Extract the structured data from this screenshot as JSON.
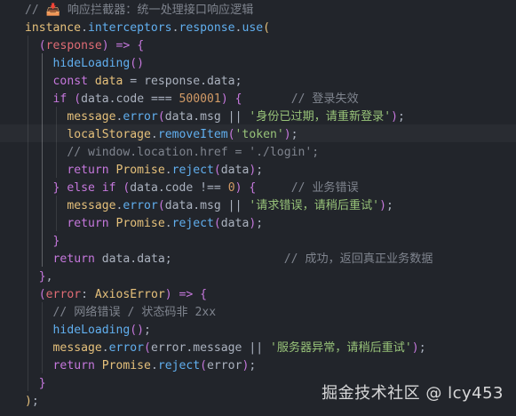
{
  "editor": {
    "background": "#22252b",
    "theme_colors": {
      "plain": "#abb2bf",
      "variable": "#e5c07b",
      "function": "#61afef",
      "keyword": "#c678dd",
      "number": "#d19a66",
      "string": "#98c379",
      "comment": "#7f848e",
      "parameter": "#e06c75"
    },
    "lines": [
      [
        [
          "t-cmt",
          "// 📥 响应拦截器：统一处理接口响应逻辑"
        ]
      ],
      [
        [
          "t-var",
          "instance"
        ],
        [
          "t-plain",
          "."
        ],
        [
          "t-prop",
          "interceptors"
        ],
        [
          "t-plain",
          "."
        ],
        [
          "t-prop",
          "response"
        ],
        [
          "t-plain",
          "."
        ],
        [
          "t-fn",
          "use"
        ],
        [
          "t-paren",
          "("
        ]
      ],
      [
        [
          "t-plain",
          "  "
        ],
        [
          "t-kw",
          "("
        ],
        [
          "t-param",
          "response"
        ],
        [
          "t-kw",
          ")"
        ],
        [
          "t-plain",
          " "
        ],
        [
          "t-kw",
          "=>"
        ],
        [
          "t-plain",
          " "
        ],
        [
          "t-kw",
          "{"
        ]
      ],
      [
        [
          "t-plain",
          "    "
        ],
        [
          "t-fn",
          "hideLoading"
        ],
        [
          "t-kw",
          "()"
        ]
      ],
      [
        [
          "t-plain",
          "    "
        ],
        [
          "t-kw",
          "const"
        ],
        [
          "t-plain",
          " "
        ],
        [
          "t-var",
          "data"
        ],
        [
          "t-plain",
          " = "
        ],
        [
          "t-plain",
          "response"
        ],
        [
          "t-plain",
          "."
        ],
        [
          "t-plain",
          "data;"
        ]
      ],
      [
        [
          "t-plain",
          "    "
        ],
        [
          "t-kw",
          "if"
        ],
        [
          "t-plain",
          " "
        ],
        [
          "t-kw",
          "("
        ],
        [
          "t-plain",
          "data"
        ],
        [
          "t-plain",
          "."
        ],
        [
          "t-plain",
          "code"
        ],
        [
          "t-plain",
          " === "
        ],
        [
          "t-num",
          "500001"
        ],
        [
          "t-kw",
          ")"
        ],
        [
          "t-plain",
          " "
        ],
        [
          "t-kw",
          "{"
        ],
        [
          "t-plain",
          "       "
        ],
        [
          "t-cmt",
          "// 登录失效"
        ]
      ],
      [
        [
          "t-plain",
          "      "
        ],
        [
          "t-var",
          "message"
        ],
        [
          "t-plain",
          "."
        ],
        [
          "t-fn",
          "error"
        ],
        [
          "t-kw",
          "("
        ],
        [
          "t-plain",
          "data"
        ],
        [
          "t-plain",
          "."
        ],
        [
          "t-plain",
          "msg"
        ],
        [
          "t-plain",
          " || "
        ],
        [
          "t-str",
          "'身份已过期，请重新登录'"
        ],
        [
          "t-kw",
          ")"
        ],
        [
          "t-plain",
          ";"
        ]
      ],
      [
        [
          "t-plain",
          "      "
        ],
        [
          "t-var",
          "localStorage"
        ],
        [
          "t-plain",
          "."
        ],
        [
          "t-fn",
          "removeItem"
        ],
        [
          "t-kw",
          "("
        ],
        [
          "t-str",
          "'token'"
        ],
        [
          "t-kw",
          ")"
        ],
        [
          "t-plain",
          ";"
        ]
      ],
      [
        [
          "t-plain",
          "      "
        ],
        [
          "t-cmt",
          "// window.location.href = './login';"
        ]
      ],
      [
        [
          "t-plain",
          "      "
        ],
        [
          "t-kw",
          "return"
        ],
        [
          "t-plain",
          " "
        ],
        [
          "t-class",
          "Promise"
        ],
        [
          "t-plain",
          "."
        ],
        [
          "t-fn",
          "reject"
        ],
        [
          "t-kw",
          "("
        ],
        [
          "t-plain",
          "data"
        ],
        [
          "t-kw",
          ")"
        ],
        [
          "t-plain",
          ";"
        ]
      ],
      [
        [
          "t-plain",
          "    "
        ],
        [
          "t-kw",
          "}"
        ],
        [
          "t-plain",
          " "
        ],
        [
          "t-kw",
          "else if"
        ],
        [
          "t-plain",
          " "
        ],
        [
          "t-kw",
          "("
        ],
        [
          "t-plain",
          "data"
        ],
        [
          "t-plain",
          "."
        ],
        [
          "t-plain",
          "code"
        ],
        [
          "t-plain",
          " !== "
        ],
        [
          "t-num",
          "0"
        ],
        [
          "t-kw",
          ")"
        ],
        [
          "t-plain",
          " "
        ],
        [
          "t-kw",
          "{"
        ],
        [
          "t-plain",
          "     "
        ],
        [
          "t-cmt",
          "// 业务错误"
        ]
      ],
      [
        [
          "t-plain",
          "      "
        ],
        [
          "t-var",
          "message"
        ],
        [
          "t-plain",
          "."
        ],
        [
          "t-fn",
          "error"
        ],
        [
          "t-kw",
          "("
        ],
        [
          "t-plain",
          "data"
        ],
        [
          "t-plain",
          "."
        ],
        [
          "t-plain",
          "msg"
        ],
        [
          "t-plain",
          " || "
        ],
        [
          "t-str",
          "'请求错误，请稍后重试'"
        ],
        [
          "t-kw",
          ")"
        ],
        [
          "t-plain",
          ";"
        ]
      ],
      [
        [
          "t-plain",
          "      "
        ],
        [
          "t-kw",
          "return"
        ],
        [
          "t-plain",
          " "
        ],
        [
          "t-class",
          "Promise"
        ],
        [
          "t-plain",
          "."
        ],
        [
          "t-fn",
          "reject"
        ],
        [
          "t-kw",
          "("
        ],
        [
          "t-plain",
          "data"
        ],
        [
          "t-kw",
          ")"
        ],
        [
          "t-plain",
          ";"
        ]
      ],
      [
        [
          "t-plain",
          "    "
        ],
        [
          "t-kw",
          "}"
        ]
      ],
      [
        [
          "t-plain",
          "    "
        ],
        [
          "t-kw",
          "return"
        ],
        [
          "t-plain",
          " "
        ],
        [
          "t-plain",
          "data"
        ],
        [
          "t-plain",
          "."
        ],
        [
          "t-plain",
          "data;"
        ],
        [
          "t-plain",
          "                "
        ],
        [
          "t-cmt",
          "// 成功，返回真正业务数据"
        ]
      ],
      [
        [
          "t-plain",
          "  "
        ],
        [
          "t-kw",
          "}"
        ],
        [
          "t-plain",
          ","
        ]
      ],
      [
        [
          "t-plain",
          "  "
        ],
        [
          "t-kw",
          "("
        ],
        [
          "t-param",
          "error"
        ],
        [
          "t-plain",
          ": "
        ],
        [
          "t-class",
          "AxiosError"
        ],
        [
          "t-kw",
          ")"
        ],
        [
          "t-plain",
          " "
        ],
        [
          "t-kw",
          "=>"
        ],
        [
          "t-plain",
          " "
        ],
        [
          "t-kw",
          "{"
        ]
      ],
      [
        [
          "t-plain",
          "    "
        ],
        [
          "t-cmt",
          "// 网络错误 / 状态码非 2xx"
        ]
      ],
      [
        [
          "t-plain",
          "    "
        ],
        [
          "t-fn",
          "hideLoading"
        ],
        [
          "t-kw",
          "()"
        ],
        [
          "t-plain",
          ";"
        ]
      ],
      [
        [
          "t-plain",
          "    "
        ],
        [
          "t-var",
          "message"
        ],
        [
          "t-plain",
          "."
        ],
        [
          "t-fn",
          "error"
        ],
        [
          "t-kw",
          "("
        ],
        [
          "t-plain",
          "error"
        ],
        [
          "t-plain",
          "."
        ],
        [
          "t-plain",
          "message"
        ],
        [
          "t-plain",
          " || "
        ],
        [
          "t-str",
          "'服务器异常，请稍后重试'"
        ],
        [
          "t-kw",
          ")"
        ],
        [
          "t-plain",
          ";"
        ]
      ],
      [
        [
          "t-plain",
          "    "
        ],
        [
          "t-kw",
          "return"
        ],
        [
          "t-plain",
          " "
        ],
        [
          "t-class",
          "Promise"
        ],
        [
          "t-plain",
          "."
        ],
        [
          "t-fn",
          "reject"
        ],
        [
          "t-kw",
          "("
        ],
        [
          "t-plain",
          "error"
        ],
        [
          "t-kw",
          ")"
        ],
        [
          "t-plain",
          ";"
        ]
      ],
      [
        [
          "t-plain",
          "  "
        ],
        [
          "t-kw",
          "}"
        ]
      ],
      [
        [
          "t-paren",
          ")"
        ],
        [
          "t-plain",
          ";"
        ]
      ]
    ]
  },
  "watermark": "掘金技术社区 @ lcy453"
}
